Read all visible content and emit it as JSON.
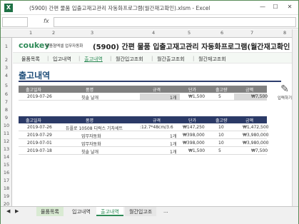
{
  "window": {
    "title": "(5900) 간편 물품 입출고재고관리 자동화프로그램(월간재고확인).xlsm - Excel",
    "app_icon": "X",
    "minimize": "—",
    "restore": "☐",
    "close": "✕"
  },
  "formula_bar": {
    "fx": "fx"
  },
  "columns": [
    "1",
    "2",
    "3",
    "4",
    "5",
    "6",
    "7",
    "8"
  ],
  "rows": [
    "1",
    "2",
    "3",
    "4",
    "5",
    "6",
    "7",
    "8",
    "9",
    "10",
    "11",
    "12",
    "13",
    "14",
    "15",
    "16",
    "17",
    "18",
    "19",
    "20"
  ],
  "logo": {
    "main": "coukey",
    "sub": "맞춤형엑셀 업무자동화"
  },
  "title": "(5900) 간편 물품 입출고재고관리 자동화프로그램(월간재고확인",
  "nav": [
    "물품목록",
    "입고내역",
    "출고내역",
    "월간입고조회",
    "월간출고조회",
    "월간재고조회"
  ],
  "nav_active": 2,
  "section": {
    "title": "출고내역",
    "input_button": "입력하기"
  },
  "input_table": {
    "headers": [
      "출고일자",
      "품명",
      "규격",
      "단가",
      "출고량",
      "금액"
    ],
    "row": [
      "2019-07-26",
      "칫솔 날개",
      "1개",
      "₩1,500",
      "5",
      "₩7,500"
    ]
  },
  "list_table": {
    "headers": [
      "출고일자",
      "품명",
      "규격",
      "단가",
      "출고량",
      "금액"
    ],
    "rows": [
      [
        "2019-07-26",
        "듀플로 10508 디럭스 기차세트",
        ":12.7*48cm/3.6",
        "₩147,250",
        "10",
        "₩1,472,500"
      ],
      [
        "2019-07-29",
        "업무자동화",
        "1개",
        "₩398,000",
        "10",
        "₩3,980,000"
      ],
      [
        "2019-07-01",
        "업무자동화",
        "1개",
        "₩398,000",
        "10",
        "₩3,980,000"
      ],
      [
        "2019-07-18",
        "칫솔 날개",
        "1개",
        "₩1,500",
        "5",
        "₩7,500"
      ]
    ]
  },
  "tabs": [
    "물품목록",
    "입고내역",
    "출고내역",
    "월간입고조"
  ],
  "tab_nav": [
    "◀",
    "▶",
    "..."
  ],
  "tab_active": 2
}
